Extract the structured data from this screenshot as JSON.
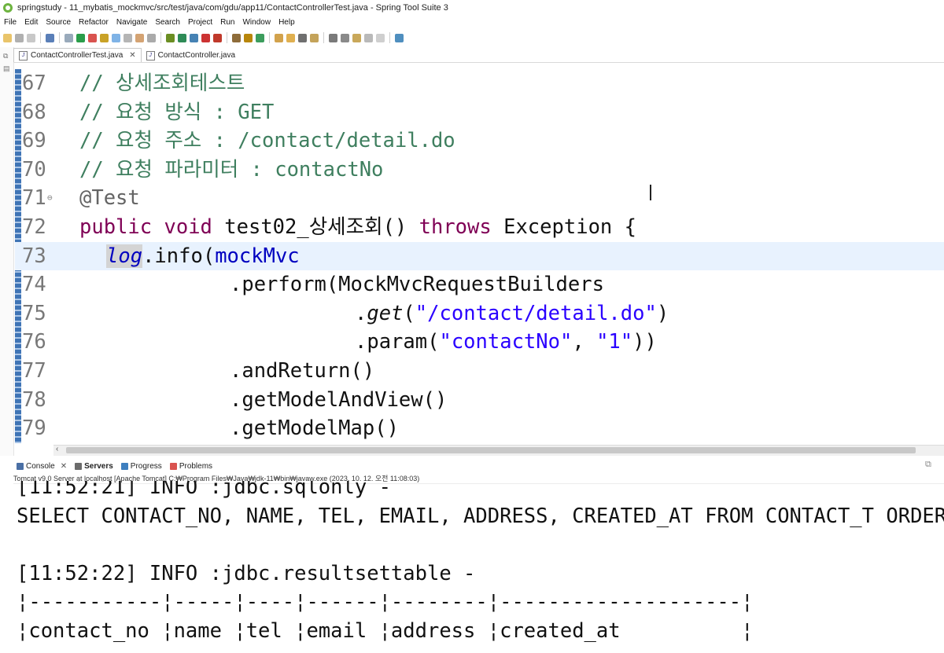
{
  "window": {
    "title": "springstudy - 11_mybatis_mockmvc/src/test/java/com/gdu/app11/ContactControllerTest.java - Spring Tool Suite 3"
  },
  "menu": [
    "File",
    "Edit",
    "Source",
    "Refactor",
    "Navigate",
    "Search",
    "Project",
    "Run",
    "Window",
    "Help"
  ],
  "editor_tabs": [
    {
      "label": "ContactControllerTest.java",
      "active": true,
      "close": "✕"
    },
    {
      "label": "ContactController.java",
      "active": false,
      "close": ""
    }
  ],
  "code_lines": [
    {
      "num": "67",
      "text": "// 상세조회테스트"
    },
    {
      "num": "68",
      "text": "// 요청 방식 : GET"
    },
    {
      "num": "69",
      "text": "// 요청 주소 : /contact/detail.do"
    },
    {
      "num": "70",
      "text": "// 요청 파라미터 : contactNo"
    },
    {
      "num": "71",
      "text": "@Test"
    },
    {
      "num": "72",
      "text": "public void test02_상세조회() throws Exception {"
    },
    {
      "num": "73",
      "text": "log.info(mockMvc"
    },
    {
      "num": "74",
      "text": ".perform(MockMvcRequestBuilders"
    },
    {
      "num": "75",
      "text": ".get(\"/contact/detail.do\")"
    },
    {
      "num": "76",
      "text": ".param(\"contactNo\", \"1\"))"
    },
    {
      "num": "77",
      "text": ".andReturn()"
    },
    {
      "num": "78",
      "text": ".getModelAndView()"
    },
    {
      "num": "79",
      "text": ".getModelMap()"
    }
  ],
  "console_tabs": [
    {
      "label": "Console",
      "close": "✕"
    },
    {
      "label": "Servers"
    },
    {
      "label": "Progress"
    },
    {
      "label": "Problems"
    }
  ],
  "console_description": "Tomcat v9.0 Server at localhost [Apache Tomcat] C:₩Program Files₩Java₩jdk-11₩bin₩javaw.exe  (2023. 10. 12. 오전 11:08:03)",
  "console_lines": [
    "[11:52:21] INFO :jdbc.sqlonly -",
    "SELECT CONTACT_NO, NAME, TEL, EMAIL, ADDRESS, CREATED_AT FROM CONTACT_T ORDER",
    "",
    "[11:52:22] INFO :jdbc.resultsettable -",
    "¦-----------¦-----¦----¦------¦--------¦--------------------¦",
    "¦contact_no ¦name ¦tel ¦email ¦address ¦created_at          ¦"
  ],
  "colors": {
    "comment": "#3f7f5f",
    "keyword": "#7f0055",
    "field": "#0000c0",
    "string": "#2a00ff",
    "annotation": "#646464",
    "current_line": "#e8f2fe"
  }
}
